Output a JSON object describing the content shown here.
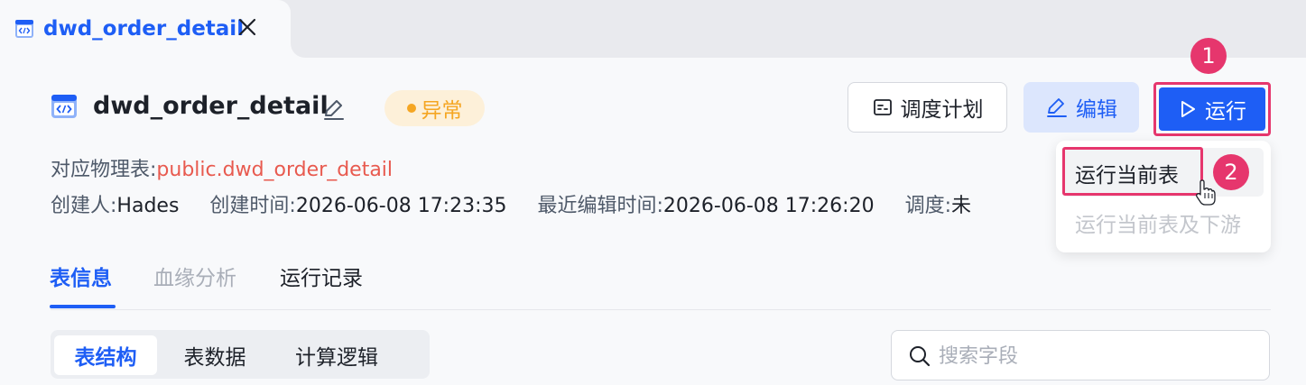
{
  "tab": {
    "title": "dwd_order_detail"
  },
  "header": {
    "title": "dwd_order_detail",
    "status": "异常",
    "status_color": "#f5a623"
  },
  "meta": {
    "physical_table_label": "对应物理表:",
    "physical_table_value": "public.dwd_order_detail",
    "creator_label": "创建人:",
    "creator_value": "Hades",
    "created_label": "创建时间:",
    "created_value": "2026-06-08 17:23:35",
    "edited_label": "最近编辑时间:",
    "edited_value": "2026-06-08 17:26:20",
    "schedule_label": "调度:",
    "schedule_value": "未"
  },
  "actions": {
    "schedule_label": "调度计划",
    "edit_label": "编辑",
    "run_label": "运行",
    "accent": "#1e5ef5",
    "annotation_color": "#e6366d"
  },
  "annotations": {
    "step1": "1",
    "step2": "2"
  },
  "run_menu": {
    "items": [
      {
        "label": "运行当前表",
        "enabled": true
      },
      {
        "label": "运行当前表及下游",
        "enabled": false
      }
    ]
  },
  "tabs": [
    {
      "label": "表信息",
      "state": "active"
    },
    {
      "label": "血缘分析",
      "state": "disabled"
    },
    {
      "label": "运行记录",
      "state": "normal"
    }
  ],
  "subtabs": [
    {
      "label": "表结构",
      "state": "active"
    },
    {
      "label": "表数据",
      "state": "normal"
    },
    {
      "label": "计算逻辑",
      "state": "normal"
    }
  ],
  "search": {
    "placeholder": "搜索字段",
    "value": ""
  }
}
